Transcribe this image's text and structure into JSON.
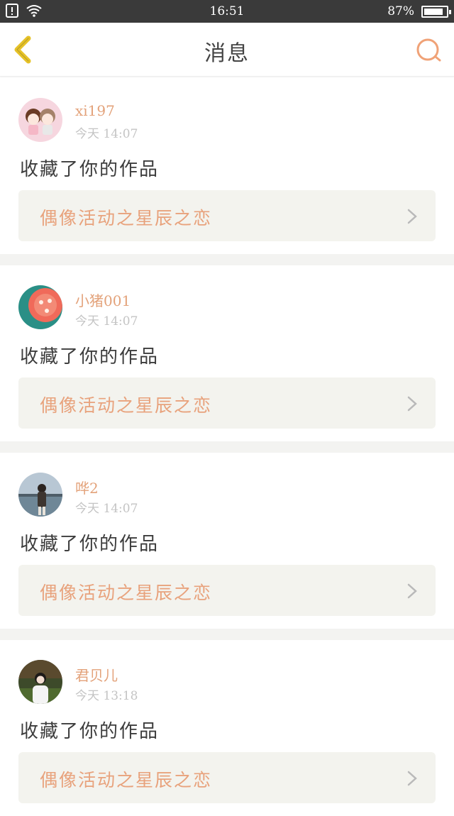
{
  "status_bar": {
    "time": "16:51",
    "battery": "87%",
    "battery_level": 0.87
  },
  "header": {
    "title": "消息"
  },
  "colors": {
    "accent": "#e8a27c",
    "back_icon": "#e6c228",
    "card_bg": "#f3f3ee"
  },
  "messages": [
    {
      "username": "xi197",
      "time": "今天 14:07",
      "action": "收藏了你的作品",
      "work_title": "偶像活动之星辰之恋",
      "avatar": "cartoon-couple-avatar"
    },
    {
      "username": "小猪001",
      "time": "今天 14:07",
      "action": "收藏了你的作品",
      "work_title": "偶像活动之星辰之恋",
      "avatar": "flower-avatar"
    },
    {
      "username": "哗2",
      "time": "今天 14:07",
      "action": "收藏了你的作品",
      "work_title": "偶像活动之星辰之恋",
      "avatar": "seaside-girl-avatar"
    },
    {
      "username": "君贝儿",
      "time": "今天 13:18",
      "action": "收藏了你的作品",
      "work_title": "偶像活动之星辰之恋",
      "avatar": "girl-photo-avatar"
    }
  ]
}
